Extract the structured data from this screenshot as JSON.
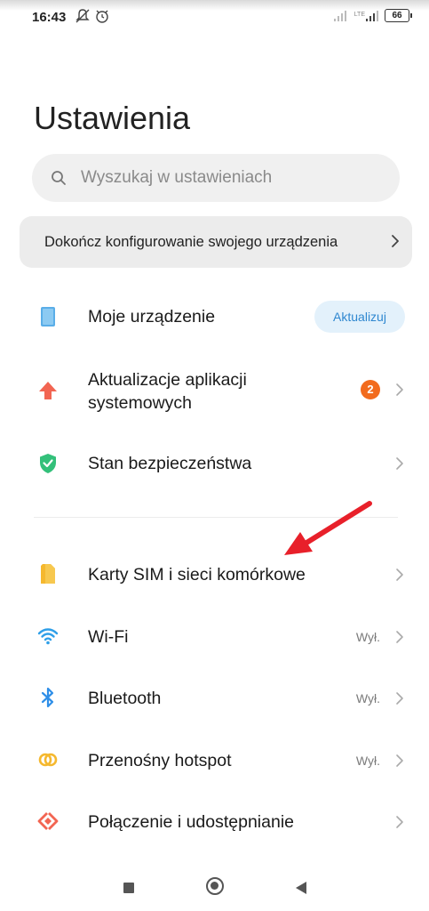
{
  "status_bar": {
    "time": "16:43",
    "left_icons": [
      "muted-notifications-icon",
      "alarm-icon"
    ],
    "network_label": "LTE",
    "battery": "66"
  },
  "page": {
    "title": "Ustawienia"
  },
  "search": {
    "placeholder": "Wyszukaj w ustawieniach"
  },
  "setup_banner": {
    "label": "Dokończ konfigurowanie swojego urządzenia"
  },
  "sections": [
    {
      "items": [
        {
          "label": "Moje urządzenie",
          "icon": "device-icon",
          "action_label": "Aktualizuj",
          "icon_color": "#5aaee8"
        },
        {
          "label_line1": "Aktualizacje aplikacji",
          "label_line2": "systemowych",
          "icon": "upload-arrow-icon",
          "badge": "2",
          "icon_color": "#f26552"
        },
        {
          "label": "Stan bezpieczeństwa",
          "icon": "shield-check-icon",
          "icon_color": "#33c07a"
        }
      ]
    },
    {
      "items": [
        {
          "label": "Karty SIM i sieci komórkowe",
          "icon": "sim-card-icon",
          "icon_color": "#f5b82e"
        },
        {
          "label": "Wi-Fi",
          "icon": "wifi-icon",
          "value": "Wył.",
          "icon_color": "#2f9fe8"
        },
        {
          "label": "Bluetooth",
          "icon": "bluetooth-icon",
          "value": "Wył.",
          "icon_color": "#2f8fe8"
        },
        {
          "label": "Przenośny hotspot",
          "icon": "hotspot-icon",
          "value": "Wył.",
          "icon_color": "#f5b82e"
        },
        {
          "label": "Połączenie i udostępnianie",
          "icon": "connection-sharing-icon",
          "icon_color": "#f26552"
        }
      ]
    }
  ],
  "annotation": {
    "color": "#e8202a"
  },
  "nav_bar": {
    "buttons": [
      "recents-button",
      "home-button",
      "back-button"
    ]
  }
}
